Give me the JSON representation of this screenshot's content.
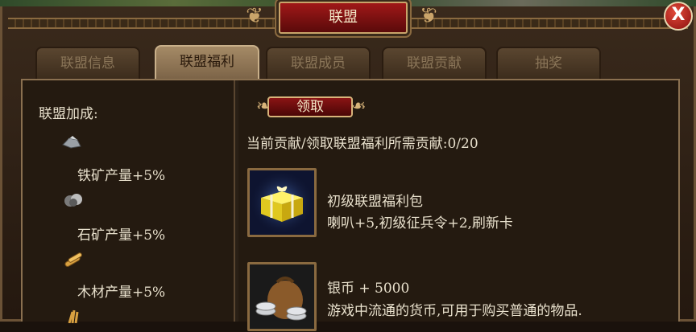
{
  "window": {
    "title": "联盟",
    "close_label": "X"
  },
  "tabs": [
    {
      "label": "联盟信息",
      "active": false
    },
    {
      "label": "联盟福利",
      "active": true
    },
    {
      "label": "联盟成员",
      "active": false
    },
    {
      "label": "联盟贡献",
      "active": false
    },
    {
      "label": "抽奖",
      "active": false
    }
  ],
  "bonus": {
    "heading": "联盟加成:",
    "items": [
      {
        "label": "铁矿产量+5%",
        "icon": "iron-ore-icon"
      },
      {
        "label": "石矿产量+5%",
        "icon": "stone-ore-icon"
      },
      {
        "label": "木材产量+5%",
        "icon": "wood-icon"
      },
      {
        "label": "",
        "icon": "grain-icon"
      }
    ]
  },
  "welfare": {
    "claim_label": "领取",
    "contribution_text": "当前贡献/领取联盟福利所需贡献:0/20",
    "rewards": [
      {
        "title": "初级联盟福利包",
        "desc": "喇叭+5,初级征兵令+2,刷新卡",
        "icon": "gift-box-icon"
      },
      {
        "title": "银币 + 5000",
        "desc": "游戏中流通的货币,可用于购买普通的物品.",
        "icon": "silver-coin-bag-icon"
      }
    ]
  },
  "colors": {
    "title_red": "#a01818",
    "gold_border": "#c9a46a",
    "text": "#e8e0cc"
  }
}
